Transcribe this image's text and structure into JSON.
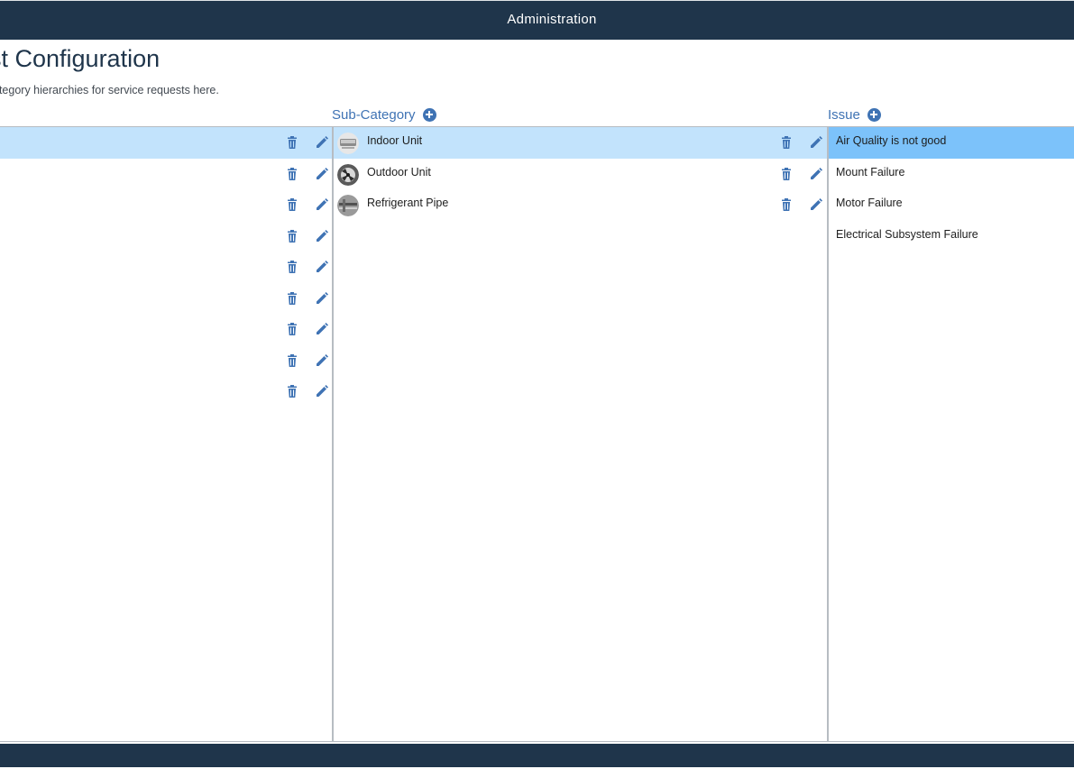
{
  "app": {
    "title": "Administration",
    "edge_glyph": ":"
  },
  "page": {
    "title": "st Configuration",
    "subtitle": "ategory hierarchies for service requests here."
  },
  "columns": {
    "subcategory_header": "Sub-Category",
    "issue_header": "Issue"
  },
  "categories": [
    {
      "label": "",
      "selected": true
    },
    {
      "label": ""
    },
    {
      "label": ""
    },
    {
      "label": ""
    },
    {
      "label": ""
    },
    {
      "label": ""
    },
    {
      "label": ""
    },
    {
      "label": ""
    },
    {
      "label": ""
    }
  ],
  "subcategories": [
    {
      "label": "Indoor Unit",
      "selected": true,
      "thumb": "indoor-unit-photo"
    },
    {
      "label": "Outdoor Unit",
      "thumb": "outdoor-unit-photo"
    },
    {
      "label": "Refrigerant Pipe",
      "thumb": "refrigerant-pipe-photo"
    }
  ],
  "issues": [
    {
      "label": "Air Quality is not good",
      "selected": true
    },
    {
      "label": "Mount Failure"
    },
    {
      "label": "Motor Failure"
    },
    {
      "label": "Electrical Subsystem Failure"
    }
  ],
  "icons": {
    "delete": "trash-icon",
    "edit": "pencil-icon",
    "add": "plus-circle-icon"
  },
  "colors": {
    "header_bg": "#1f354b",
    "accent": "#3f73b4",
    "selected_light": "#c2e3fc",
    "selected_strong": "#7cc2fa"
  }
}
